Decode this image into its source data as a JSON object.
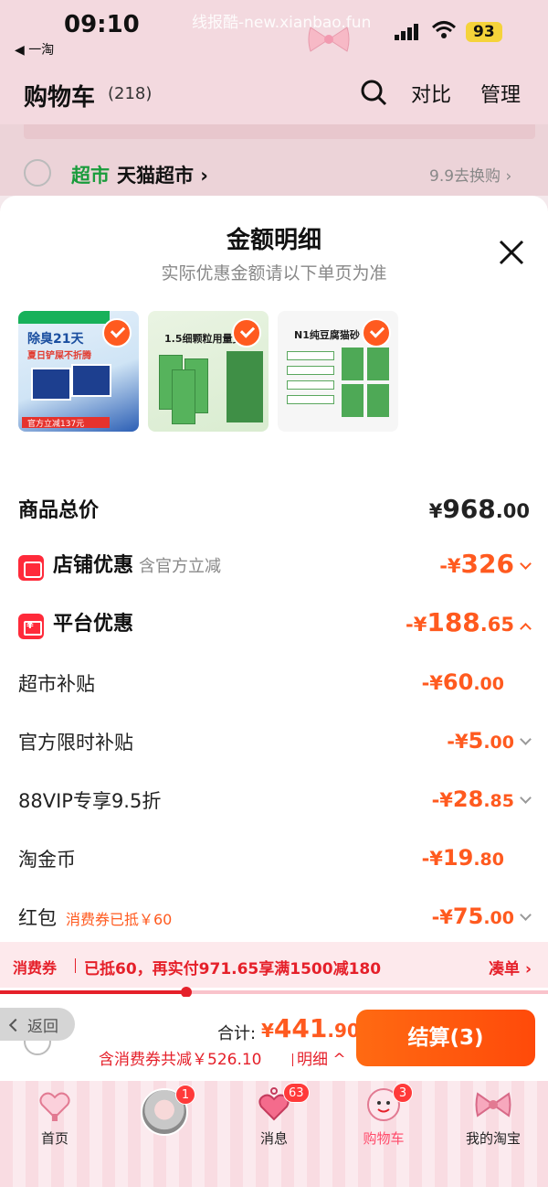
{
  "status_bar": {
    "time": "09:10",
    "back_app": "◀ 一淘",
    "watermark": "线报酷-new.xianbao.fun",
    "battery": "93"
  },
  "header": {
    "title": "购物车",
    "count": "(218)",
    "compare": "对比",
    "manage": "管理"
  },
  "background_store": {
    "tag": "超市",
    "name": "天猫超市 ›",
    "exchange": "9.9去换购 ›"
  },
  "sheet": {
    "title": "金额明细",
    "subtitle": "实际优惠金额请以下单页为准",
    "products": [
      {
        "label_a": "除臭21天",
        "label_b": "夏日铲屎不折腾",
        "bottom": "官方立减137元"
      },
      {
        "label_a": "1.5细颗粒用量更"
      },
      {
        "label_a": "N1纯豆腐猫砂 1"
      }
    ],
    "rows": {
      "total": {
        "label": "商品总价",
        "yen": "¥",
        "int": "968",
        "dec": ".00"
      },
      "store_discount": {
        "label": "店铺优惠",
        "note": "含官方立减",
        "prefix": "-¥",
        "int": "326",
        "dec": ""
      },
      "platform_discount": {
        "label": "平台优惠",
        "prefix": "-¥",
        "int": "188",
        "dec": ".65"
      },
      "supermarket_subsidy": {
        "label": "超市补贴",
        "prefix": "-¥",
        "int": "60",
        "dec": ".00"
      },
      "official_limited": {
        "label": "官方限时补贴",
        "prefix": "-¥",
        "int": "5",
        "dec": ".00"
      },
      "vip_discount": {
        "label": "88VIP专享9.5折",
        "prefix": "-¥",
        "int": "28",
        "dec": ".85"
      },
      "taojinbi": {
        "label": "淘金币",
        "prefix": "-¥",
        "int": "19",
        "dec": ".80"
      },
      "red_packet": {
        "label": "红包",
        "note": "消费券已抵￥60",
        "prefix": "-¥",
        "int": "75",
        "dec": ".00"
      }
    }
  },
  "coupon": {
    "tag": "消费券",
    "text": "已抵60，再实付971.65享满1500减180",
    "more": "凑单 ›",
    "progress": 0.34
  },
  "checkout": {
    "back": "返回",
    "total_label": "合计:",
    "total_prefix": "¥",
    "total_int": "441",
    "total_dec": ".90",
    "savings": "含消费券共减￥526.10",
    "detail": "明细 ^",
    "button": "结算(3)"
  },
  "tabs": [
    {
      "label": "首页",
      "icon": "home-heart-icon"
    },
    {
      "label": "",
      "icon": "avatar",
      "badge": "1"
    },
    {
      "label": "消息",
      "icon": "message-heart-icon",
      "badge": "63"
    },
    {
      "label": "购物车",
      "icon": "cart-icon",
      "badge": "3",
      "active": true
    },
    {
      "label": "我的淘宝",
      "icon": "bow-icon"
    }
  ],
  "colors": {
    "accent": "#ff5a1f",
    "red": "#e5202a",
    "green_tag": "#1a9c3c",
    "header_bg": "#f3d9df"
  }
}
